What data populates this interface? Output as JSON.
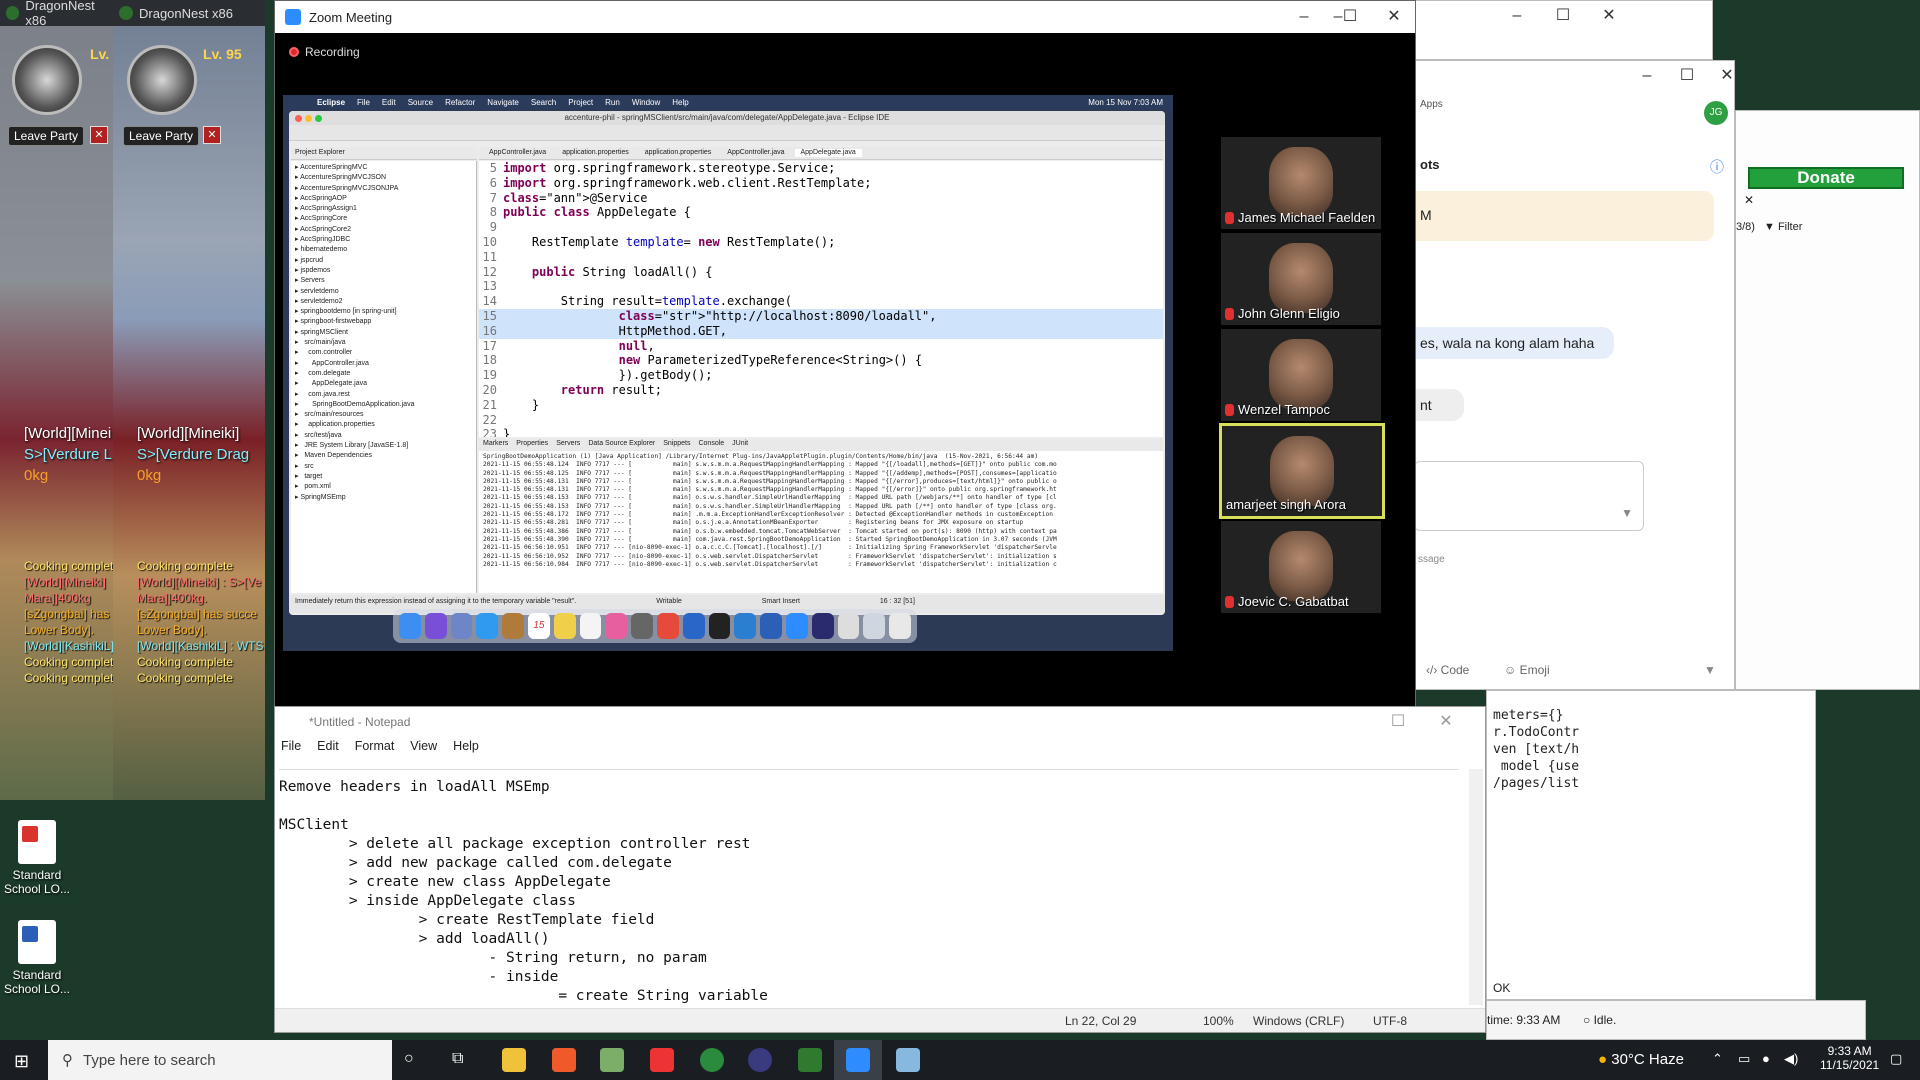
{
  "game": {
    "windows": [
      {
        "title": "DragonNest x86",
        "level": "Lv.",
        "leave_label": "Leave Party",
        "world_name": "[World][Minei",
        "world_sub": "S>[Verdure L",
        "kg": "0kg"
      },
      {
        "title": "DragonNest x86",
        "level": "Lv. 95",
        "leave_label": "Leave Party",
        "world_name": "[World][Mineiki]",
        "world_sub": "S>[Verdure Drag",
        "kg": "0kg"
      }
    ],
    "chat1": [
      "Cooking complete",
      "[World][Mineiki]",
      "Mara]]400kg",
      "[sZgongbai] has",
      "Lower Body].",
      "[World][KashikiL]",
      "Cooking complete",
      "Cooking complete"
    ],
    "chat2": [
      "Cooking complete",
      "[World][Mineiki] : S>[Ve",
      "Mara]]400kg.",
      "[sZgongbai] has succe",
      "Lower Body].",
      "[World][KashikiL] : WTS",
      "Cooking complete",
      "Cooking complete"
    ]
  },
  "desktop_icons": [
    {
      "label": "Standard School LO..."
    },
    {
      "label": "Standard School LO..."
    }
  ],
  "bg_right": {
    "apps_label": "Apps",
    "donate_label": "Donate",
    "filter_label": "Filter",
    "count_label": "3/8)",
    "bots_label": "ots",
    "msg1": "M",
    "msg2": "es, wala na kong alam haha",
    "msg3": "nt",
    "code_label": "Code",
    "emoji_label": "Emoji",
    "message_placeholder": "ssage",
    "time_label": "time: 9:33 AM",
    "idle_label": "Idle.",
    "ok_label": "OK",
    "code_lines": [
      "meters={}",
      "r.TodoContr",
      "",
      "",
      "ven [text/h",
      " model {use",
      "/pages/list"
    ],
    "avatar_initials": "JG"
  },
  "zoom": {
    "title": "Zoom Meeting",
    "recording_label": "Recording",
    "participants": [
      {
        "name": "James Michael Faelden"
      },
      {
        "name": "John Glenn Eligio"
      },
      {
        "name": "Wenzel Tampoc"
      },
      {
        "name": "amarjeet singh Arora"
      },
      {
        "name": "Joevic C. Gabatbat"
      }
    ]
  },
  "mac": {
    "menu": [
      "Eclipse",
      "File",
      "Edit",
      "Source",
      "Refactor",
      "Navigate",
      "Search",
      "Project",
      "Run",
      "Window",
      "Help"
    ],
    "clock": "Mon 15 Nov  7:03 AM"
  },
  "eclipse": {
    "title": "accenture-phil - springMSClient/src/main/java/com/delegate/AppDelegate.java - Eclipse IDE",
    "tree_header": "Project Explorer",
    "tree": [
      "AccentureSpringMVC",
      "AccentureSpringMVCJSON",
      "AccentureSpringMVCJSONJPA",
      "AccSpringAOP",
      "AccSpringAssign1",
      "AccSpringCore",
      "AccSpringCore2",
      "AccSpringJDBC",
      "hibernatedemo",
      "jspcrud",
      "jspdemos",
      "Servers",
      "servletdemo",
      "servletdemo2",
      "springbootdemo [in spring-unit]",
      "springboot-firstwebapp",
      "springMSClient",
      "  src/main/java",
      "    com.controller",
      "      AppController.java",
      "    com.delegate",
      "      AppDelegate.java",
      "    com.java.rest",
      "      SpringBootDemoApplication.java",
      "  src/main/resources",
      "    application.properties",
      "  src/test/java",
      "  JRE System Library [JavaSE-1.8]",
      "  Maven Dependencies",
      "  src",
      "  target",
      "  pom.xml",
      "SpringMSEmp"
    ],
    "tabs": [
      "AppController.java",
      "application.properties",
      "application.properties",
      "AppController.java",
      "AppDelegate.java"
    ],
    "code": [
      {
        "n": "5",
        "t": "import org.springframework.stereotype.Service;",
        "hl": false
      },
      {
        "n": "6",
        "t": "import org.springframework.web.client.RestTemplate;",
        "hl": false
      },
      {
        "n": "7",
        "t": "@Service",
        "hl": false
      },
      {
        "n": "8",
        "t": "public class AppDelegate {",
        "hl": false
      },
      {
        "n": "9",
        "t": "",
        "hl": false
      },
      {
        "n": "10",
        "t": "    RestTemplate template= new RestTemplate();",
        "hl": false
      },
      {
        "n": "11",
        "t": "",
        "hl": false
      },
      {
        "n": "12",
        "t": "    public String loadAll() {",
        "hl": false
      },
      {
        "n": "13",
        "t": "",
        "hl": false
      },
      {
        "n": "14",
        "t": "        String result=template.exchange(",
        "hl": false
      },
      {
        "n": "15",
        "t": "                \"http://localhost:8090/loadall\",",
        "hl": true
      },
      {
        "n": "16",
        "t": "                HttpMethod.GET,",
        "hl": true
      },
      {
        "n": "17",
        "t": "                null,",
        "hl": false
      },
      {
        "n": "18",
        "t": "                new ParameterizedTypeReference<String>() {",
        "hl": false
      },
      {
        "n": "19",
        "t": "                }).getBody();",
        "hl": false
      },
      {
        "n": "20",
        "t": "        return result;",
        "hl": false
      },
      {
        "n": "21",
        "t": "    }",
        "hl": false
      },
      {
        "n": "22",
        "t": "",
        "hl": false
      },
      {
        "n": "23",
        "t": "}",
        "hl": false
      }
    ],
    "console_tabs": [
      "Markers",
      "Properties",
      "Servers",
      "Data Source Explorer",
      "Snippets",
      "Console",
      "JUnit"
    ],
    "console": [
      "SpringBootDemoApplication (1) [Java Application] /Library/Internet Plug-ins/JavaAppletPlugin.plugin/Contents/Home/bin/java  (15-Nov-2021, 6:56:44 am)",
      "2021-11-15 06:55:48.124  INFO 7717 --- [           main] s.w.s.m.m.a.RequestMappingHandlerMapping : Mapped \"{[/loadall],methods=[GET]}\" onto public com.mo",
      "2021-11-15 06:55:48.125  INFO 7717 --- [           main] s.w.s.m.m.a.RequestMappingHandlerMapping : Mapped \"{[/addemp],methods=[POST],consumes=[applicatio",
      "2021-11-15 06:55:48.131  INFO 7717 --- [           main] s.w.s.m.m.a.RequestMappingHandlerMapping : Mapped \"{[/error],produces=[text/html]}\" onto public o",
      "2021-11-15 06:55:48.131  INFO 7717 --- [           main] s.w.s.m.m.a.RequestMappingHandlerMapping : Mapped \"{[/error]}\" onto public org.springframework.ht",
      "2021-11-15 06:55:48.153  INFO 7717 --- [           main] o.s.w.s.handler.SimpleUrlHandlerMapping  : Mapped URL path [/webjars/**] onto handler of type [cl",
      "2021-11-15 06:55:48.153  INFO 7717 --- [           main] o.s.w.s.handler.SimpleUrlHandlerMapping  : Mapped URL path [/**] onto handler of type [class org.",
      "2021-11-15 06:55:48.172  INFO 7717 --- [           main] .m.m.a.ExceptionHandlerExceptionResolver : Detected @ExceptionHandler methods in customException",
      "2021-11-15 06:55:48.281  INFO 7717 --- [           main] o.s.j.e.a.AnnotationMBeanExporter        : Registering beans for JMX exposure on startup",
      "2021-11-15 06:55:48.386  INFO 7717 --- [           main] o.s.b.w.embedded.tomcat.TomcatWebServer  : Tomcat started on port(s): 8090 (http) with context pa",
      "2021-11-15 06:55:48.390  INFO 7717 --- [           main] com.java.rest.SpringBootDemoApplication  : Started SpringBootDemoApplication in 3.07 seconds (JVM",
      "2021-11-15 06:56:10.951  INFO 7717 --- [nio-8090-exec-1] o.a.c.c.C.[Tomcat].[localhost].[/]       : Initializing Spring FrameworkServlet 'dispatcherServle",
      "2021-11-15 06:56:10.952  INFO 7717 --- [nio-8090-exec-1] o.s.web.servlet.DispatcherServlet        : FrameworkServlet 'dispatcherServlet': initialization s",
      "2021-11-15 06:56:10.984  INFO 7717 --- [nio-8090-exec-1] o.s.web.servlet.DispatcherServlet        : FrameworkServlet 'dispatcherServlet': initialization c"
    ],
    "status_hint": "Immediately return this expression instead of assigning it to the temporary variable \"result\".",
    "status_writable": "Writable",
    "status_insert": "Smart Insert",
    "status_pos": "16 : 32 [51]",
    "dock_badge": "15"
  },
  "notepad": {
    "title": "*Untitled - Notepad",
    "menu": [
      "File",
      "Edit",
      "Format",
      "View",
      "Help"
    ],
    "text": "Remove headers in loadAll MSEmp\n\nMSClient\n        > delete all package exception controller rest\n        > add new package called com.delegate\n        > create new class AppDelegate\n        > inside AppDelegate class\n                > create RestTemplate field\n                > add loadAll()\n                        - String return, no param\n                        - inside\n                                = create String variable",
    "status": {
      "pos": "Ln 22, Col 29",
      "zoom": "100%",
      "eol": "Windows (CRLF)",
      "enc": "UTF-8"
    }
  },
  "taskbar": {
    "search_placeholder": "Type here to search",
    "weather": "30°C  Haze",
    "time": "9:33 AM",
    "date": "11/15/2021"
  }
}
